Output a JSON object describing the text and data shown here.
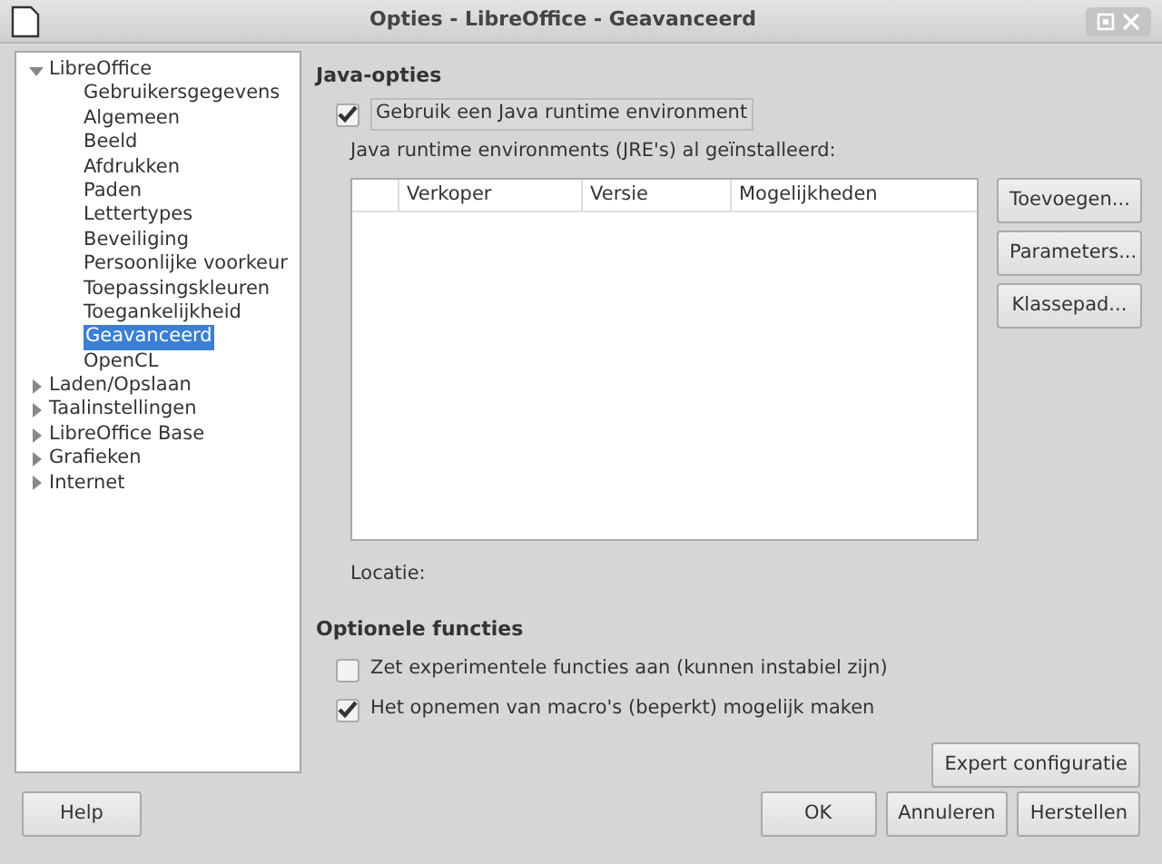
{
  "window": {
    "title": "Opties - LibreOffice - Geavanceerd"
  },
  "tree": [
    {
      "label": "LibreOffice",
      "expanded": true,
      "children": [
        {
          "label": "Gebruikersgegevens",
          "selected": false
        },
        {
          "label": "Algemeen",
          "selected": false
        },
        {
          "label": "Beeld",
          "selected": false
        },
        {
          "label": "Afdrukken",
          "selected": false
        },
        {
          "label": "Paden",
          "selected": false
        },
        {
          "label": "Lettertypes",
          "selected": false
        },
        {
          "label": "Beveiliging",
          "selected": false
        },
        {
          "label": "Persoonlijke voorkeur",
          "selected": false
        },
        {
          "label": "Toepassingskleuren",
          "selected": false
        },
        {
          "label": "Toegankelijkheid",
          "selected": false
        },
        {
          "label": "Geavanceerd",
          "selected": true
        },
        {
          "label": "OpenCL",
          "selected": false
        }
      ]
    },
    {
      "label": "Laden/Opslaan",
      "expanded": false
    },
    {
      "label": "Taalinstellingen",
      "expanded": false
    },
    {
      "label": "LibreOffice Base",
      "expanded": false
    },
    {
      "label": "Grafieken",
      "expanded": false
    },
    {
      "label": "Internet",
      "expanded": false
    }
  ],
  "java": {
    "heading": "Java-opties",
    "use_jre": {
      "label": "Gebruik een Java runtime environment",
      "checked": true
    },
    "installed_label": "Java runtime environments (JRE's) al geïnstalleerd:",
    "table": {
      "columns": [
        "Verkoper",
        "Versie",
        "Mogelijkheden"
      ]
    },
    "buttons": [
      "Toevoegen...",
      "Parameters...",
      "Klassepad..."
    ],
    "location_label": "Locatie:"
  },
  "optional": {
    "heading": "Optionele functies",
    "options": [
      {
        "label": "Zet experimentele functies aan (kunnen instabiel zijn)",
        "checked": false
      },
      {
        "label": "Het opnemen van macro's (beperkt) mogelijk maken",
        "checked": true
      }
    ],
    "expert_button": "Expert configuratie"
  },
  "footer": {
    "help": "Help",
    "buttons": [
      "OK",
      "Annuleren",
      "Herstellen"
    ]
  }
}
